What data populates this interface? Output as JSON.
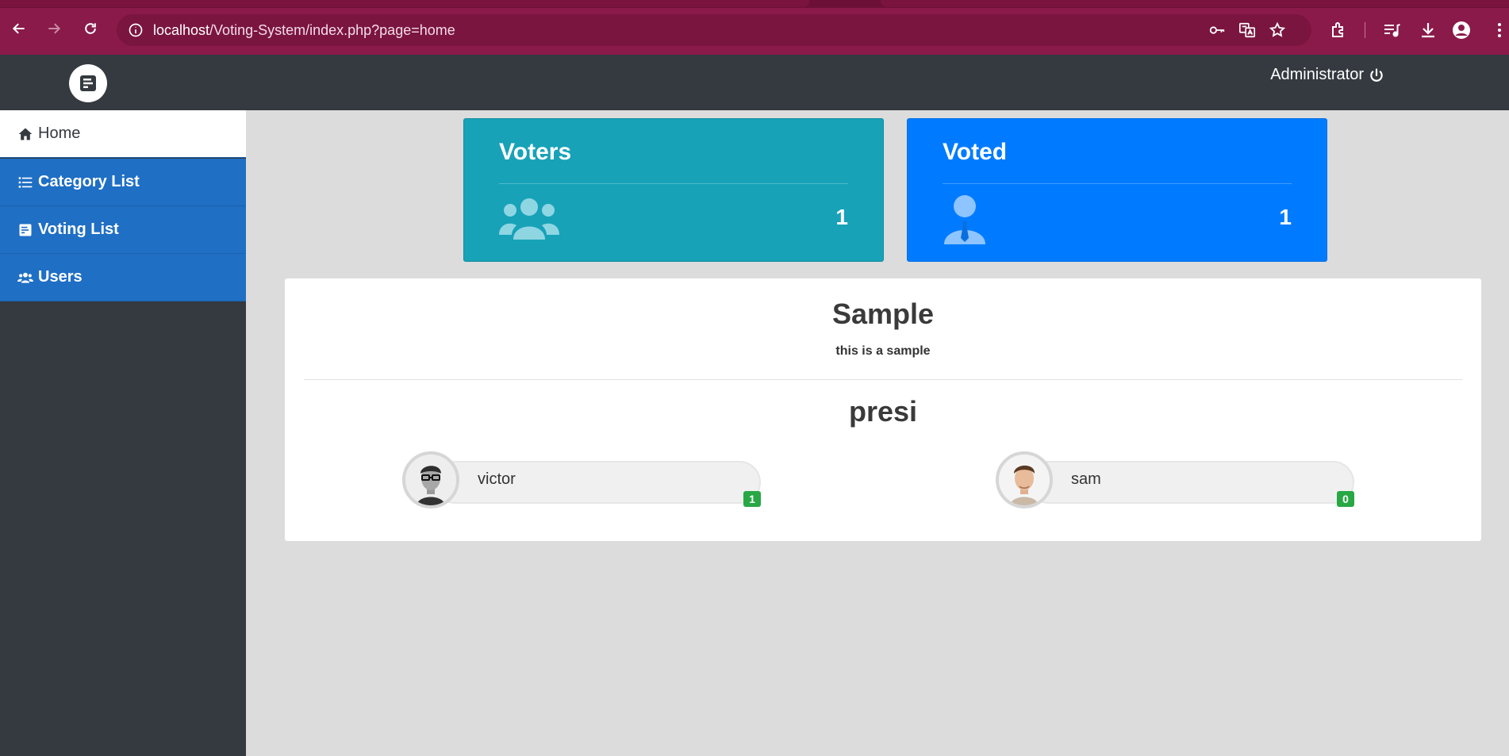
{
  "browser": {
    "url_host": "localhost",
    "url_path": "/Voting-System/index.php?page=home"
  },
  "header": {
    "user_label": "Administrator"
  },
  "sidebar": {
    "items": [
      {
        "label": "Home",
        "icon": "home-icon",
        "active": true
      },
      {
        "label": "Category List",
        "icon": "list-icon",
        "active": false
      },
      {
        "label": "Voting List",
        "icon": "poll-icon",
        "active": false
      },
      {
        "label": "Users",
        "icon": "users-icon",
        "active": false
      }
    ]
  },
  "stats": {
    "voters": {
      "title": "Voters",
      "value": "1",
      "color": "#17a2b8",
      "icon": "users-icon"
    },
    "voted": {
      "title": "Voted",
      "value": "1",
      "color": "#007bff",
      "icon": "user-tie-icon"
    }
  },
  "poll": {
    "title": "Sample",
    "description": "this is a sample",
    "category": "presi",
    "candidates": [
      {
        "name": "victor",
        "votes": "1"
      },
      {
        "name": "sam",
        "votes": "0"
      }
    ]
  },
  "colors": {
    "sidebar_blue": "#1f6fc4",
    "header_dark": "#343a40",
    "badge_green": "#28a745",
    "browser_chrome": "#8a1a4a"
  }
}
